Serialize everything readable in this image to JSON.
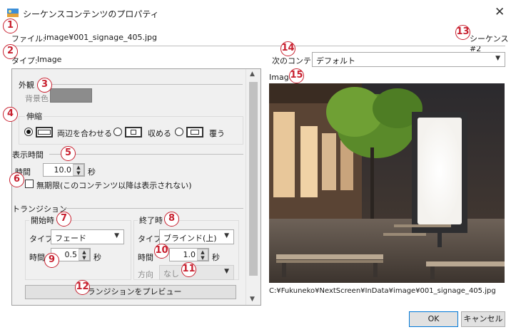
{
  "window": {
    "title": "シーケンスコンテンツのプロパティ",
    "close_glyph": "✕"
  },
  "file_line": {
    "label": "ファイル:",
    "value": "image¥001_signage_405.jpg",
    "sequence": "シーケンス #2"
  },
  "type_line": {
    "label": "タイプ:",
    "value": "Image"
  },
  "next_content": {
    "label": "次のコンテンツ",
    "selected": "デフォルト"
  },
  "appearance": {
    "heading": "外観",
    "bgcolor_label": "背景色"
  },
  "stretch": {
    "heading": "伸縮",
    "options": [
      {
        "label": "両辺を合わせる",
        "selected": true
      },
      {
        "label": "収める",
        "selected": false
      },
      {
        "label": "覆う",
        "selected": false
      }
    ]
  },
  "display_time": {
    "heading": "表示時間",
    "time_label": "時間",
    "value": "10.0",
    "unit": "秒",
    "infinite_label": "無期限(このコンテンツ以降は表示されない)",
    "infinite_checked": false
  },
  "transition": {
    "heading": "トランジション",
    "start": {
      "heading": "開始時",
      "type_label": "タイプ",
      "type_value": "フェード",
      "time_label": "時間",
      "time_value": "0.5",
      "unit": "秒"
    },
    "end": {
      "heading": "終了時",
      "type_label": "タイプ",
      "type_value": "ブラインド(上)",
      "time_label": "時間",
      "time_value": "1.0",
      "unit": "秒",
      "direction_label": "方向",
      "direction_value": "なし"
    },
    "preview_button": "トランジションをプレビュー"
  },
  "preview": {
    "heading": "Image",
    "path": "C:¥Fukuneko¥NextScreen¥InData¥image¥001_signage_405.jpg"
  },
  "buttons": {
    "ok": "OK",
    "cancel": "キャンセル"
  },
  "callouts": [
    "1",
    "2",
    "3",
    "4",
    "5",
    "6",
    "7",
    "8",
    "9",
    "10",
    "11",
    "12",
    "13",
    "14",
    "15"
  ],
  "colors": {
    "callout": "#c8202f",
    "bg_swatch": "#8c8c8c",
    "default_button_border": "#0078d7"
  }
}
